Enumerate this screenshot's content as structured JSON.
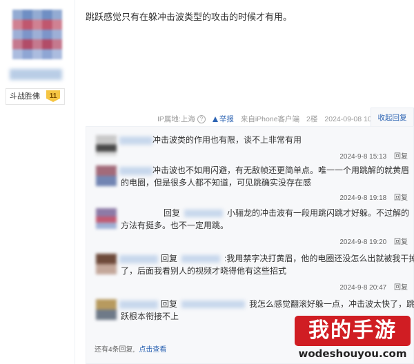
{
  "user": {
    "level_name": "斗战胜佛",
    "level_number": "11"
  },
  "post": {
    "text": "跳跃感觉只有在躲冲击波类型的攻击的时候才有用。",
    "tail": {
      "ip_label": "IP属地:上海",
      "help_icon": "?",
      "report_label": "举报",
      "client_label": "来自iPhone客户端",
      "floor": "2楼",
      "datetime": "2024-09-08 10:18"
    },
    "collapse_label": "收起回复"
  },
  "replies": [
    {
      "line1": "冲击波类的作用也有限，谈不上非常有用",
      "line2": "",
      "time": "2024-9-8 15:13",
      "reply_label": "回复"
    },
    {
      "line1": "冲击波也不如用闪避，有无敌帧还更简单点。唯一一个用跳解的就黄眉",
      "line2": "的电圈，但是很多人都不知道，可见跳确实没存在感",
      "time": "2024-9-8 19:18",
      "reply_label": "回复"
    },
    {
      "prefix": "回复",
      "line1": "小骊龙的冲击波有一段用跳闪跳才好躲。不过解的",
      "line2": "方法有挺多。也不一定用跳。",
      "time": "2024-9-8 19:20",
      "reply_label": "回复"
    },
    {
      "prefix": "回复",
      "line1": ":我用禁字决打黄眉，他的电圈还没怎么出就被我干掉",
      "line2": "了，后面我看别人的视频才晓得他有这些招式",
      "time": "2024-9-8 20:47",
      "reply_label": "回复"
    },
    {
      "prefix": "回复",
      "line1": "我怎么感觉翻滚好躲一点，冲击波太快了，跳",
      "line2": "跃根本衔接不上",
      "time": "",
      "reply_label": ""
    }
  ],
  "more": {
    "text": "还有4条回复,",
    "link": "点击查看"
  },
  "watermark": {
    "title": "我的手游",
    "url": "wodeshouyou.com"
  },
  "colors": {
    "link_blue": "#2d64b3",
    "watermark_red": "#d01d23",
    "badge_gold": "#f5c543"
  }
}
